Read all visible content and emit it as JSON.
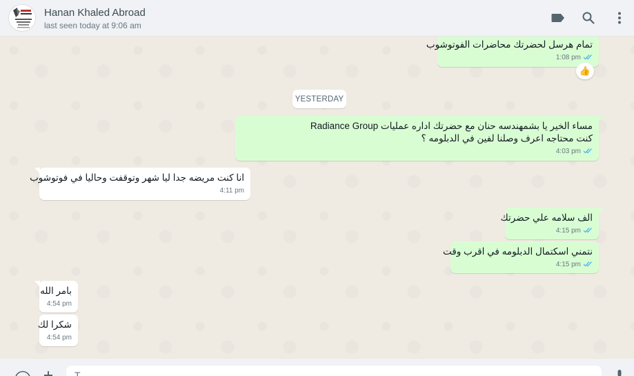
{
  "header": {
    "name": "Hanan Khaled Abroad",
    "status": "last seen today at 9:06 am"
  },
  "chat": {
    "messages": [
      {
        "text": "تمام هرسل لحضرتك محاضرات الفوتوشوب",
        "time": "1:08 pm",
        "direction": "outgoing",
        "ticks": "read"
      },
      {
        "text_line1": "مساء الخير يا بشمهندسه حنان مع حضرتك اداره عمليات Radiance Group",
        "text_line2": "كنت محتاجه اعرف وصلنا لفين في الدبلومه ؟",
        "time": "4:03 pm",
        "direction": "outgoing",
        "ticks": "read"
      },
      {
        "text": "انا كنت مريضه جدا ليا شهر وتوقفت وحاليا في فوتوشوب",
        "time": "4:11 pm",
        "direction": "incoming"
      },
      {
        "text": "الف سلامه علي حضرتك",
        "time": "4:15 pm",
        "direction": "outgoing",
        "ticks": "read"
      },
      {
        "text": "نتمني اسكتمال الدبلومه في اقرب وقت",
        "time": "4:15 pm",
        "direction": "outgoing",
        "ticks": "read"
      },
      {
        "text": "بامر الله",
        "time": "4:54 pm",
        "direction": "incoming"
      },
      {
        "text": "شكرا لك",
        "time": "4:54 pm",
        "direction": "incoming"
      }
    ],
    "date_separator": "YESTERDAY",
    "reaction": "👍"
  },
  "composer": {
    "placeholder": "T"
  },
  "colors": {
    "outgoing": "#d9fdd3",
    "incoming": "#ffffff",
    "tick_read": "#53bdeb",
    "background": "#efeae2"
  },
  "icons": [
    "label-icon",
    "search-icon",
    "menu-icon",
    "emoji-icon",
    "attach-icon",
    "mic-icon",
    "read-ticks-icon"
  ]
}
